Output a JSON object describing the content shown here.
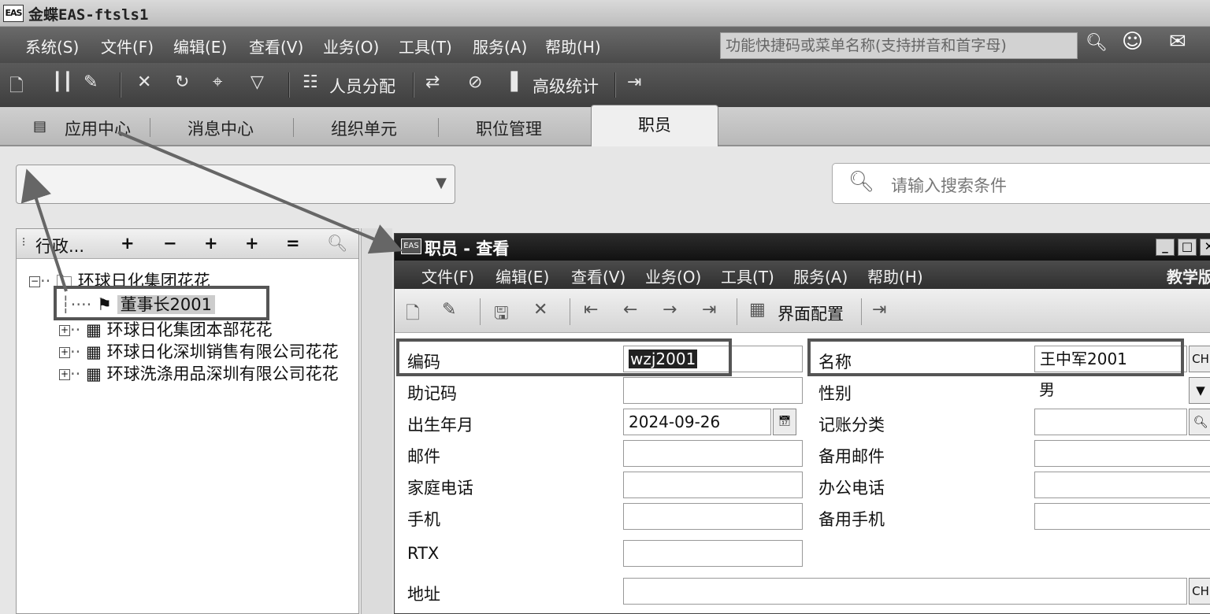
{
  "window": {
    "logo": "EAS",
    "title": "金蝶EAS-ftsls1"
  },
  "menubar": {
    "items": [
      "系统(S)",
      "文件(F)",
      "编辑(E)",
      "查看(V)",
      "业务(O)",
      "工具(T)",
      "服务(A)",
      "帮助(H)"
    ],
    "quick_search_placeholder": "功能快捷码或菜单名称(支持拼音和首字母)",
    "icons": [
      "search-icon",
      "smiley-icon",
      "message-icon"
    ]
  },
  "toolbar": {
    "staff_assign": "人员分配",
    "advanced_stats": "高级统计"
  },
  "tabs": {
    "app_center": "应用中心",
    "message_center": "消息中心",
    "org_unit": "组织单元",
    "position_mgmt": "职位管理",
    "staff": "职员"
  },
  "search": {
    "placeholder": "请输入搜索条件"
  },
  "tree": {
    "header_label": "行政...",
    "header_buttons": [
      "+",
      "−",
      "+",
      "+",
      "="
    ],
    "root": "环球日化集团花花",
    "selected": "董事长2001",
    "nodes": [
      "环球日化集团本部花花",
      "环球日化深圳销售有限公司花花",
      "环球洗涤用品深圳有限公司花花"
    ]
  },
  "dialog": {
    "title": "职员 - 查看",
    "menu": [
      "文件(F)",
      "编辑(E)",
      "查看(V)",
      "业务(O)",
      "工具(T)",
      "服务(A)",
      "帮助(H)"
    ],
    "menu_right": "教学版",
    "toolbar_label": "界面配置",
    "fields": {
      "code_label": "编码",
      "code_value": "wzj2001",
      "name_label": "名称",
      "name_value": "王中军2001",
      "name_lang": "CH",
      "mnemonic_label": "助记码",
      "mnemonic_value": "",
      "gender_label": "性别",
      "gender_value": "男",
      "birth_label": "出生年月",
      "birth_value": "2024-09-26",
      "acct_label": "记账分类",
      "acct_value": "",
      "email_label": "邮件",
      "email_value": "",
      "email2_label": "备用邮件",
      "email2_value": "",
      "homephone_label": "家庭电话",
      "homephone_value": "",
      "officephone_label": "办公电话",
      "officephone_value": "",
      "mobile_label": "手机",
      "mobile_value": "",
      "mobile2_label": "备用手机",
      "mobile2_value": "",
      "rtx_label": "RTX",
      "rtx_value": "",
      "address_label": "地址",
      "address_value": "",
      "address_lang": "CH"
    }
  }
}
